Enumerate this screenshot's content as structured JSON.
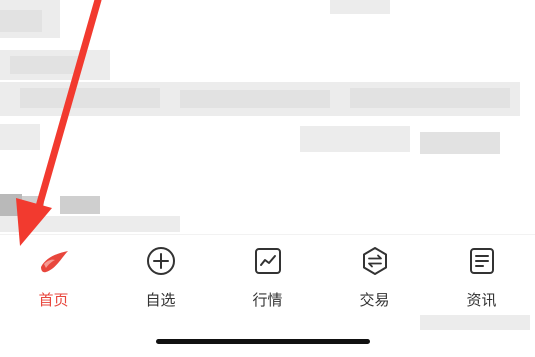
{
  "tabbar": {
    "items": [
      {
        "label": "首页",
        "icon": "home-logo-icon",
        "active": true
      },
      {
        "label": "自选",
        "icon": "plus-circle-icon",
        "active": false
      },
      {
        "label": "行情",
        "icon": "chart-line-icon",
        "active": false
      },
      {
        "label": "交易",
        "icon": "exchange-hexagon-icon",
        "active": false
      },
      {
        "label": "资讯",
        "icon": "news-doc-icon",
        "active": false
      }
    ]
  },
  "colors": {
    "accent": "#e8463c",
    "arrow": "#f23a2f",
    "text": "#333333"
  }
}
